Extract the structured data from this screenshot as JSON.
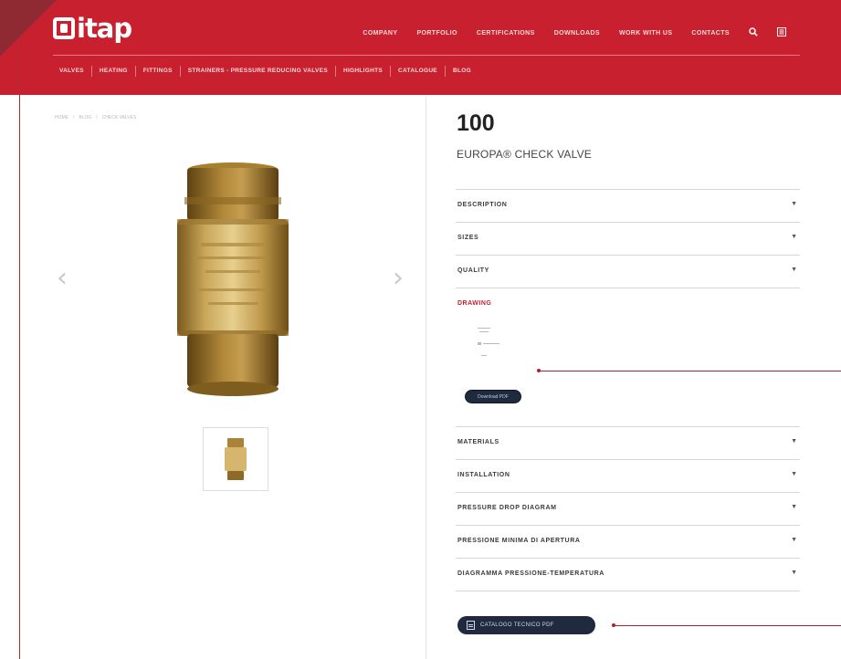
{
  "brand": {
    "logo_text": "itap",
    "accent": "#c8202e",
    "dark_button": "#1f2a3f"
  },
  "topnav": {
    "items": [
      "COMPANY",
      "PORTFOLIO",
      "CERTIFICATIONS",
      "DOWNLOADS",
      "WORK WITH US",
      "CONTACTS"
    ],
    "icons": [
      "search-icon",
      "menu-icon"
    ]
  },
  "subnav": {
    "items": [
      "VALVES",
      "HEATING",
      "FITTINGS",
      "STRAINERS - PRESSURE REDUCING VALVES",
      "HIGHLIGHTS",
      "CATALOGUE",
      "BLOG"
    ]
  },
  "breadcrumb": [
    "HOME",
    "/",
    "BLOG",
    "/",
    "CHECK VALVES"
  ],
  "product": {
    "code": "100",
    "name": "EUROPA® CHECK VALVE"
  },
  "accordion_top": [
    "DESCRIPTION",
    "SIZES",
    "QUALITY"
  ],
  "drawing": {
    "label": "DRAWING",
    "button": "Download PDF"
  },
  "accordion_bottom": [
    "MATERIALS",
    "INSTALLATION",
    "PRESSURE DROP DIAGRAM",
    "PRESSIONE MINIMA DI APERTURA",
    "DIAGRAMMA PRESSIONE-TEMPERATURA"
  ],
  "catalog_button": "CATALOGO TECNICO PDF",
  "gallery": {
    "prev_icon": "chevron-left-icon",
    "next_icon": "chevron-right-icon"
  }
}
